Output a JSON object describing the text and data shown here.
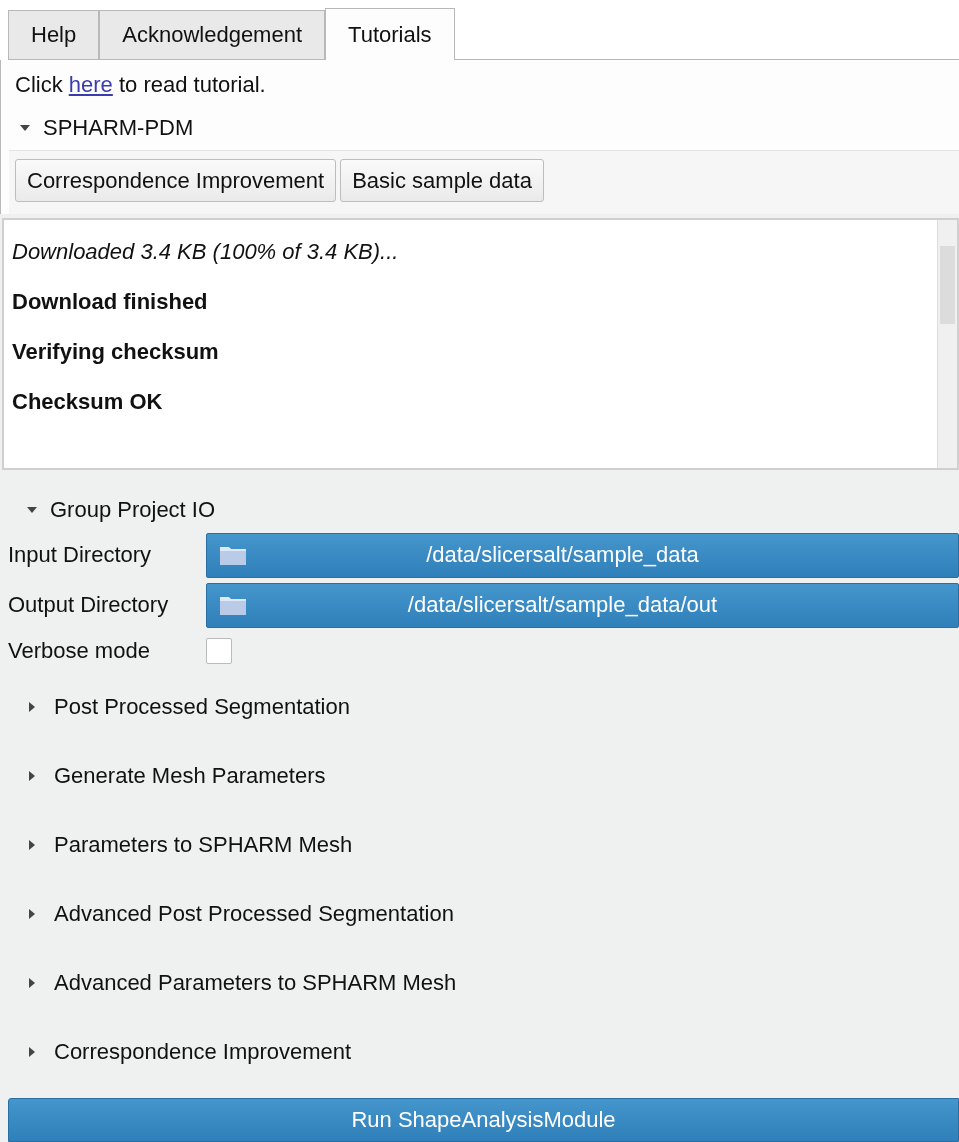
{
  "tabs": [
    {
      "label": "Help",
      "selected": false
    },
    {
      "label": "Acknowledgement",
      "selected": false
    },
    {
      "label": "Tutorials",
      "selected": true
    }
  ],
  "tutorial_link": {
    "before": "Click ",
    "link": "here",
    "after": " to read tutorial."
  },
  "spharm_section": {
    "title": "SPHARM-PDM",
    "expanded": true,
    "buttons": [
      "Correspondence Improvement",
      "Basic sample data"
    ]
  },
  "log": [
    {
      "kind": "italic",
      "text": "Downloaded 3.4 KB (100% of 3.4 KB)..."
    },
    {
      "kind": "bold",
      "text": "Download finished"
    },
    {
      "kind": "bold",
      "text": "Verifying checksum"
    },
    {
      "kind": "bold",
      "text": "Checksum OK"
    }
  ],
  "group_io": {
    "title": "Group Project IO",
    "expanded": true,
    "fields": [
      {
        "kind": "directory",
        "label": "Input Directory",
        "value": "/data/slicersalt/sample_data"
      },
      {
        "kind": "directory",
        "label": "Output Directory",
        "value": "/data/slicersalt/sample_data/out"
      },
      {
        "kind": "checkbox",
        "label": "Verbose mode",
        "checked": false
      }
    ]
  },
  "sections": [
    {
      "title": "Post Processed Segmentation",
      "expanded": false
    },
    {
      "title": "Generate Mesh Parameters",
      "expanded": false
    },
    {
      "title": "Parameters to SPHARM Mesh",
      "expanded": false
    },
    {
      "title": "Advanced Post Processed Segmentation",
      "expanded": false
    },
    {
      "title": "Advanced Parameters to SPHARM Mesh",
      "expanded": false
    },
    {
      "title": "Correspondence Improvement",
      "expanded": false
    }
  ],
  "run_button": "Run ShapeAnalysisModule"
}
